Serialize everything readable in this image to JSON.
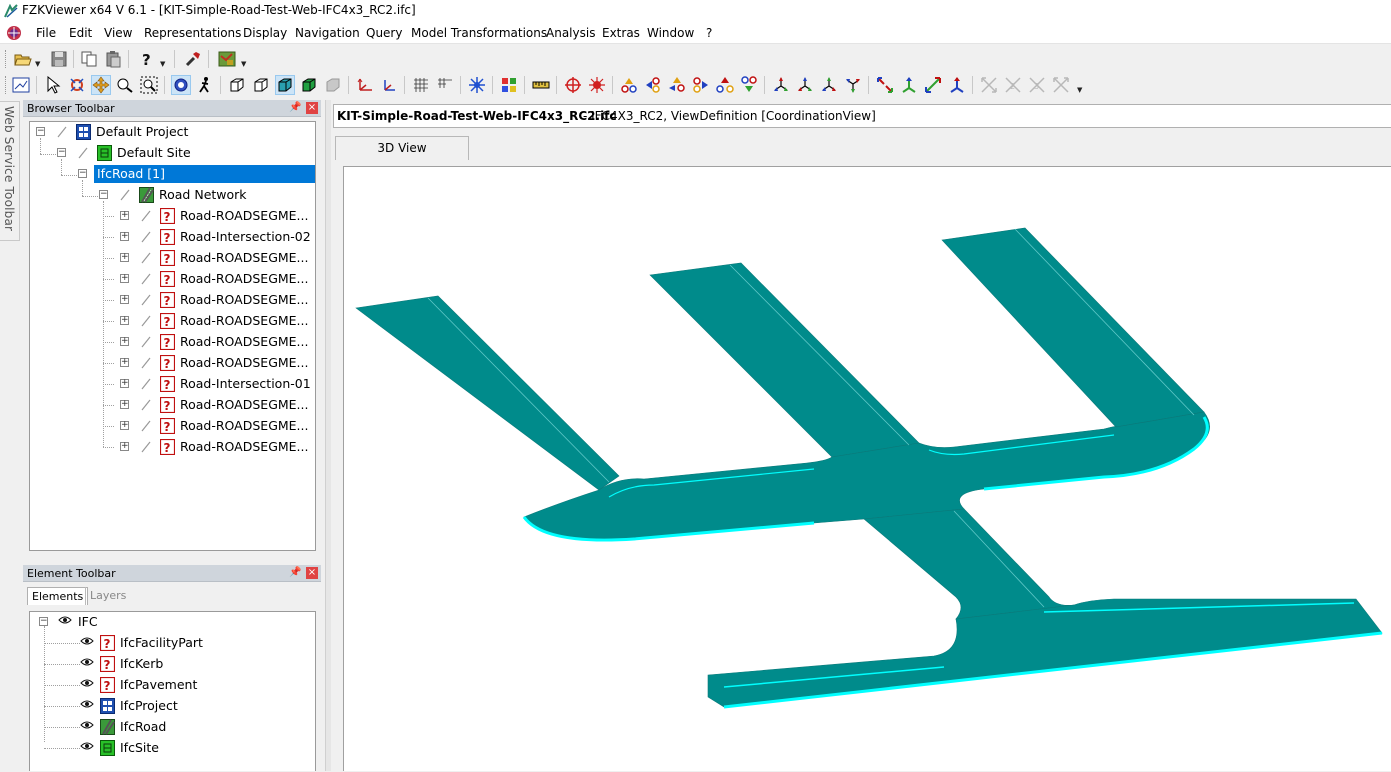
{
  "window": {
    "title": "FZKViewer x64 V 6.1 - [KIT-Simple-Road-Test-Web-IFC4x3_RC2.ifc]"
  },
  "menu": [
    "File",
    "Edit",
    "View",
    "Representations",
    "Display",
    "Navigation",
    "Query",
    "Model Transformations",
    "Analysis",
    "Extras",
    "Window",
    "?"
  ],
  "side_tab": {
    "label": "Web Service Toolbar"
  },
  "browser_panel": {
    "title": "Browser Toolbar",
    "tree": [
      {
        "label": "Default Project",
        "icon": "project-icon"
      },
      {
        "label": "Default Site",
        "icon": "site-icon"
      },
      {
        "label": "IfcRoad [1]",
        "icon": "none",
        "selected": true
      },
      {
        "label": "Road Network",
        "icon": "road-icon"
      },
      {
        "label": "Road-ROADSEGME...",
        "icon": "unknown-icon"
      },
      {
        "label": "Road-Intersection-02",
        "icon": "unknown-icon"
      },
      {
        "label": "Road-ROADSEGME...",
        "icon": "unknown-icon"
      },
      {
        "label": "Road-ROADSEGME...",
        "icon": "unknown-icon"
      },
      {
        "label": "Road-ROADSEGME...",
        "icon": "unknown-icon"
      },
      {
        "label": "Road-ROADSEGME...",
        "icon": "unknown-icon"
      },
      {
        "label": "Road-ROADSEGME...",
        "icon": "unknown-icon"
      },
      {
        "label": "Road-ROADSEGME...",
        "icon": "unknown-icon"
      },
      {
        "label": "Road-Intersection-01",
        "icon": "unknown-icon"
      },
      {
        "label": "Road-ROADSEGME...",
        "icon": "unknown-icon"
      },
      {
        "label": "Road-ROADSEGME...",
        "icon": "unknown-icon"
      },
      {
        "label": "Road-ROADSEGME...",
        "icon": "unknown-icon"
      }
    ]
  },
  "element_panel": {
    "title": "Element Toolbar",
    "tabs": [
      "Elements",
      "Layers"
    ],
    "active_tab": "Elements",
    "root": "IFC",
    "items": [
      {
        "label": "IfcFacilityPart",
        "icon": "unknown-icon"
      },
      {
        "label": "IfcKerb",
        "icon": "unknown-icon"
      },
      {
        "label": "IfcPavement",
        "icon": "unknown-icon"
      },
      {
        "label": "IfcProject",
        "icon": "project-icon"
      },
      {
        "label": "IfcRoad",
        "icon": "road-icon"
      },
      {
        "label": "IfcSite",
        "icon": "site-icon"
      }
    ]
  },
  "document": {
    "file_name": "KIT-Simple-Road-Test-Web-IFC4x3_RC2.ifc",
    "meta": " - IFC4X3_RC2, ViewDefinition [CoordinationView]",
    "view_tab": "3D View"
  },
  "colors": {
    "road_fill": "#008b8b",
    "road_edge": "#00ffff",
    "selection": "#0078d7",
    "panel_header": "#cfd5dc"
  }
}
